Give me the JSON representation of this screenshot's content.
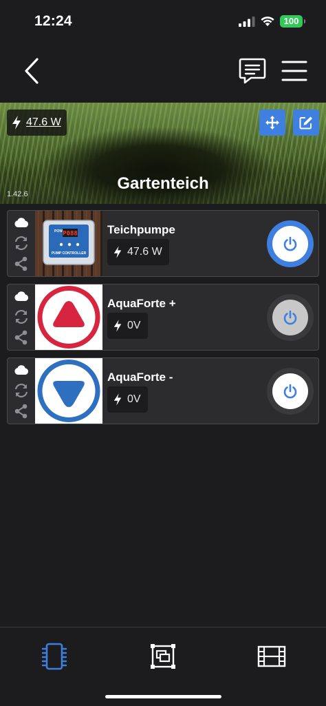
{
  "status_bar": {
    "time": "12:24",
    "battery": "100"
  },
  "header": {
    "back_icon": "chevron-left-icon",
    "chat_icon": "message-icon",
    "menu_icon": "hamburger-menu-icon"
  },
  "hero": {
    "power_value": "47.6 W",
    "title": "Gartenteich",
    "version": "1.42.6",
    "accent": "#3f7fe0"
  },
  "devices": [
    {
      "name": "Teichpumpe",
      "value": "47.6 W",
      "state": "on",
      "thumb": "pump-controller",
      "controller_display": "P088",
      "controller_label": "PUMP CONTROLLER"
    },
    {
      "name": "AquaForte +",
      "value": "0V",
      "state": "off",
      "thumb": "up-arrow-red"
    },
    {
      "name": "AquaForte -",
      "value": "0V",
      "state": "off",
      "thumb": "down-arrow-blue"
    }
  ],
  "tabbar": {
    "items": [
      {
        "icon": "chip-icon",
        "active": true
      },
      {
        "icon": "groups-icon",
        "active": false
      },
      {
        "icon": "film-icon",
        "active": false
      }
    ],
    "active_color": "#3f7fe0"
  }
}
